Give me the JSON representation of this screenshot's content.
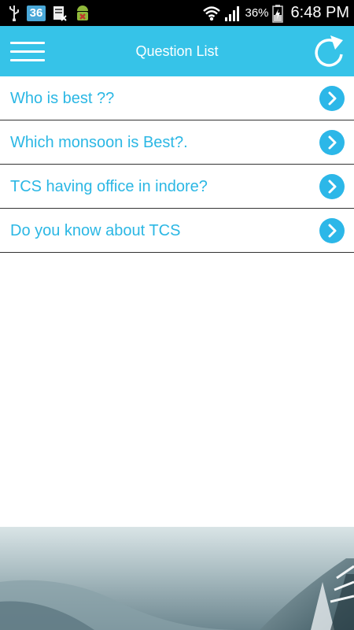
{
  "status_bar": {
    "notification_badge": "36",
    "battery_percent": "36%",
    "time": "6:48 PM"
  },
  "app_bar": {
    "title": "Question List",
    "menu_icon": "hamburger-menu-icon",
    "refresh_icon": "refresh-icon"
  },
  "questions": [
    {
      "text": "Who is best ??"
    },
    {
      "text": "Which monsoon is Best?."
    },
    {
      "text": "TCS having office in indore?"
    },
    {
      "text": "Do you know about TCS"
    }
  ],
  "colors": {
    "app_bar": "#36c3e8",
    "question_text": "#2bb7e4",
    "arrow_button": "#2cb7e8",
    "divider": "#333333"
  }
}
